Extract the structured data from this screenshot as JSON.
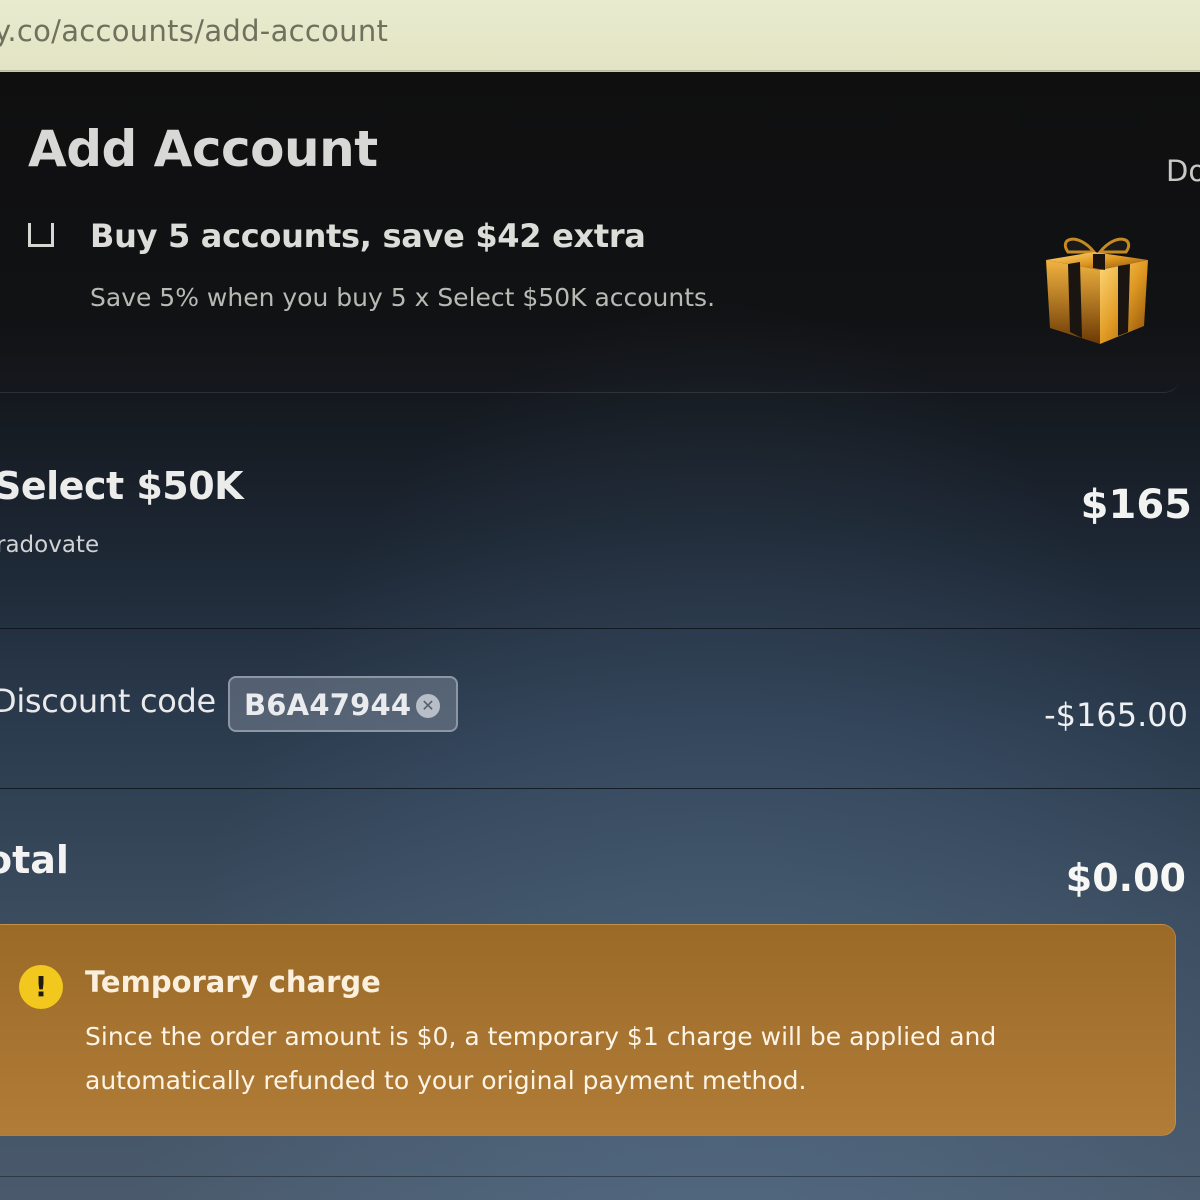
{
  "browser": {
    "url": "y.co/accounts/add-account"
  },
  "header": {
    "title": "Add Account",
    "top_right_text": "Do"
  },
  "bundle_offer": {
    "checked": false,
    "title": "Buy 5 accounts, save $42 extra",
    "subtitle": "Save 5% when you buy 5 x Select $50K accounts.",
    "icon": "gift-icon"
  },
  "order": {
    "product_name": "Select $50K",
    "platform": "radovate",
    "price": "$165",
    "discount_label": "Discount code",
    "discount_code": "B6A47944",
    "discount_amount": "-$165.00",
    "total_label": "otal",
    "total_amount": "$0.00"
  },
  "notice": {
    "title": "Temporary charge",
    "body": "Since the order amount is $0, a temporary $1 charge will be applied and automatically refunded to your original payment method.",
    "icon": "warning-icon",
    "color": "#a67330",
    "icon_color": "#f2c81f"
  }
}
